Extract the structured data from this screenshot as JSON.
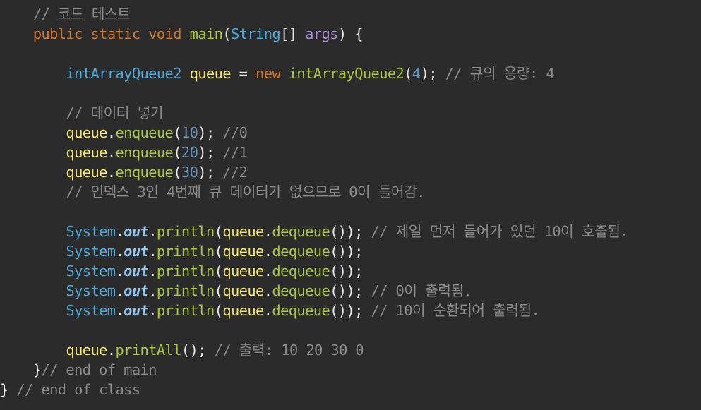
{
  "colors": {
    "background": "#2b2b2b",
    "keyword": "#cc7832",
    "method": "#a9c544",
    "type": "#4fa9d6",
    "variable": "#f2e46e",
    "field": "#93c7ee",
    "number": "#6897bb",
    "parameter": "#a98dcf",
    "comment": "#8a8a8a",
    "punctuation": "#e6e6e6"
  },
  "code": {
    "l01": {
      "indent": "    ",
      "comment": "// 코드 테스트"
    },
    "l02": {
      "indent": "    ",
      "kw_public": "public",
      "kw_static": "static",
      "kw_void": "void",
      "method": "main",
      "param_type": "String",
      "brackets": "[]",
      "param_name": "args",
      "brace": "{"
    },
    "l03": {
      "indent": "        ",
      "type": "intArrayQueue2",
      "var": "queue",
      "op": "=",
      "kw_new": "new",
      "ctor": "intArrayQueue2",
      "arg": "4",
      "comment": "// 큐의 용량: 4"
    },
    "l04": {
      "indent": "        ",
      "comment": "// 데이터 넣기"
    },
    "l05": {
      "indent": "        ",
      "var": "queue",
      "method": "enqueue",
      "arg": "10",
      "comment": "//0"
    },
    "l06": {
      "indent": "        ",
      "var": "queue",
      "method": "enqueue",
      "arg": "20",
      "comment": "//1"
    },
    "l07": {
      "indent": "        ",
      "var": "queue",
      "method": "enqueue",
      "arg": "30",
      "comment": "//2"
    },
    "l08": {
      "indent": "        ",
      "comment": "// 인덱스 3인 4번째 큐 데이터가 없으므로 0이 들어감."
    },
    "l09": {
      "indent": "        ",
      "cls": "System",
      "field": "out",
      "method": "println",
      "var": "queue",
      "inner": "dequeue",
      "comment": "// 제일 먼저 들어가 있던 10이 호출됨."
    },
    "l10": {
      "indent": "        ",
      "cls": "System",
      "field": "out",
      "method": "println",
      "var": "queue",
      "inner": "dequeue",
      "comment": ""
    },
    "l11": {
      "indent": "        ",
      "cls": "System",
      "field": "out",
      "method": "println",
      "var": "queue",
      "inner": "dequeue",
      "comment": ""
    },
    "l12": {
      "indent": "        ",
      "cls": "System",
      "field": "out",
      "method": "println",
      "var": "queue",
      "inner": "dequeue",
      "comment": "// 0이 출력됨."
    },
    "l13": {
      "indent": "        ",
      "cls": "System",
      "field": "out",
      "method": "println",
      "var": "queue",
      "inner": "dequeue",
      "comment": "// 10이 순환되어 출력됨."
    },
    "l14": {
      "indent": "        ",
      "var": "queue",
      "method": "printAll",
      "comment": "// 출력: 10 20 30 0"
    },
    "l15": {
      "indent": "    ",
      "brace": "}",
      "comment": "// end of main"
    },
    "l16": {
      "brace": "}",
      "comment": "// end of class"
    }
  }
}
